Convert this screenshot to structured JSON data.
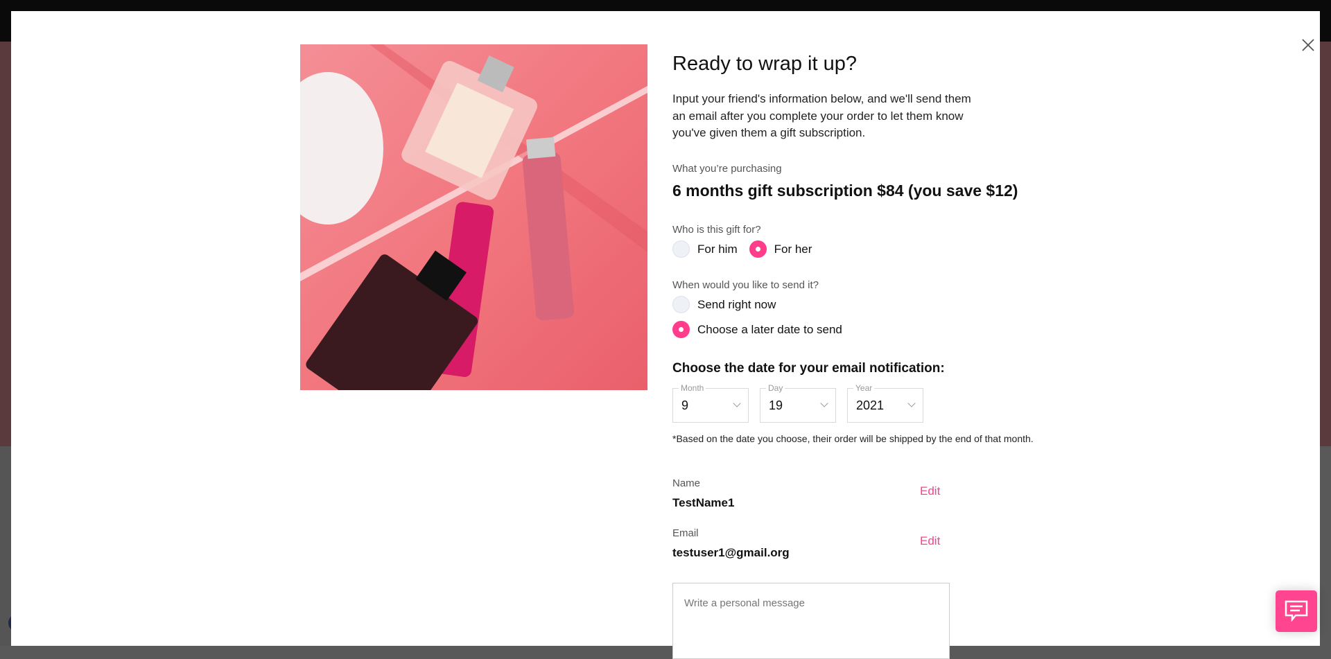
{
  "modal": {
    "title": "Ready to wrap it up?",
    "intro": "Input your friend's information below, and we'll send them an email after you complete your order to let them know you've given them a gift subscription.",
    "purchase_label": "What you’re purchasing",
    "purchase_value": "6 months gift subscription $84 (you save $12)",
    "recipient": {
      "label": "Who is this gift for?",
      "options": [
        {
          "label": "For him",
          "selected": false
        },
        {
          "label": "For her",
          "selected": true
        }
      ]
    },
    "send": {
      "label": "When would you like to send it?",
      "options": [
        {
          "label": "Send right now",
          "selected": false
        },
        {
          "label": "Choose a later date to send",
          "selected": true
        }
      ]
    },
    "date_heading": "Choose the date for your email notification:",
    "date": {
      "month_label": "Month",
      "month": "9",
      "day_label": "Day",
      "day": "19",
      "year_label": "Year",
      "year": "2021"
    },
    "note": "*Based on the date you choose, their order will be shipped by the end of that month.",
    "name_label": "Name",
    "name_value": "TestName1",
    "email_label": "Email",
    "email_value": "testuser1@gmail.org",
    "edit_label": "Edit",
    "message_placeholder": "Write a personal message"
  },
  "colors": {
    "accent": "#ff3d8b"
  },
  "icons": {
    "close": "close-icon",
    "chat": "chat-icon"
  }
}
